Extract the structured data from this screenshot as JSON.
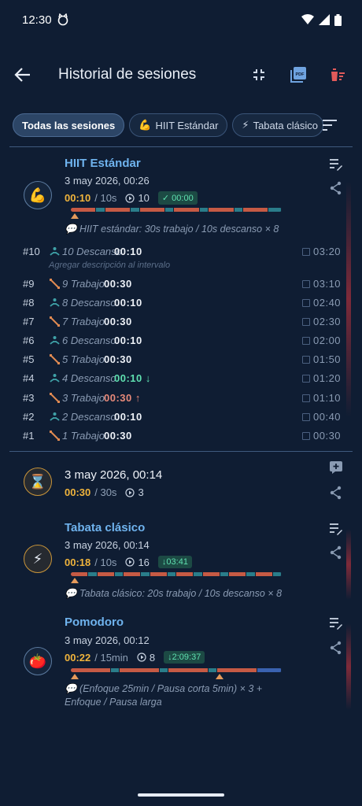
{
  "status": {
    "time": "12:30"
  },
  "appbar": {
    "title": "Historial de sesiones"
  },
  "filters": [
    {
      "icon": "",
      "label": "Todas las sesiones"
    },
    {
      "icon": "💪",
      "label": "HIIT Estándar"
    },
    {
      "icon": "⚡",
      "label": "Tabata clásico"
    }
  ],
  "colors": {
    "work": "#c65a44",
    "rest": "#2a7d8a",
    "longrest": "#3a62b0",
    "accent": "#f0b43c",
    "title": "#6fb3ee",
    "badge": "#5fe0b0"
  },
  "sessions": [
    {
      "name": "HIIT Estándar",
      "icon": "💪",
      "date": "3 may 2026, 00:26",
      "duration": "00:10",
      "total": "/ 10s",
      "cycles": "10",
      "badge": "✓ 00:00",
      "note": "💬 HIIT estándar: 30s trabajo / 10s descanso × 8",
      "add_description": "Agregar descripción al intervalo",
      "intervals": [
        {
          "num": "#10",
          "type": "rest",
          "label": "10 Descanso",
          "value": "00:10",
          "time": "03:20"
        },
        {
          "num": "#9",
          "type": "work",
          "label": "9 Trabajo",
          "value": "00:30",
          "time": "03:10"
        },
        {
          "num": "#8",
          "type": "rest",
          "label": "8 Descanso",
          "value": "00:10",
          "time": "02:40"
        },
        {
          "num": "#7",
          "type": "work",
          "label": "7 Trabajo",
          "value": "00:30",
          "time": "02:30"
        },
        {
          "num": "#6",
          "type": "rest",
          "label": "6 Descanso",
          "value": "00:10",
          "time": "02:00"
        },
        {
          "num": "#5",
          "type": "work",
          "label": "5 Trabajo",
          "value": "00:30",
          "time": "01:50"
        },
        {
          "num": "#4",
          "type": "rest",
          "label": "4 Descanso",
          "value": "00:10 ↓",
          "time": "01:20",
          "highlight": "green"
        },
        {
          "num": "#3",
          "type": "work",
          "label": "3 Trabajo",
          "value": "00:30 ↑",
          "time": "01:10",
          "highlight": "red"
        },
        {
          "num": "#2",
          "type": "rest",
          "label": "2 Descanso",
          "value": "00:10",
          "time": "00:40"
        },
        {
          "num": "#1",
          "type": "work",
          "label": "1 Trabajo",
          "value": "00:30",
          "time": "00:30"
        }
      ]
    },
    {
      "name": "",
      "icon": "⌛",
      "date": "3 may 2026, 00:14",
      "duration": "00:30",
      "total": "/ 30s",
      "cycles": "3"
    },
    {
      "name": "Tabata clásico",
      "icon": "⚡",
      "date": "3 may 2026, 00:14",
      "duration": "00:18",
      "total": "/ 10s",
      "cycles": "16",
      "badge": "↓03:41",
      "note": "💬 Tabata clásico: 20s trabajo / 10s descanso × 8"
    },
    {
      "name": "Pomodoro",
      "icon": "🍅",
      "date": "3 may 2026, 00:12",
      "duration": "00:22",
      "total": "/ 15min",
      "cycles": "8",
      "badge": "↓2:09:37",
      "note": "💬 (Enfoque 25min / Pausa corta 5min) × 3 + Enfoque / Pausa larga"
    }
  ]
}
